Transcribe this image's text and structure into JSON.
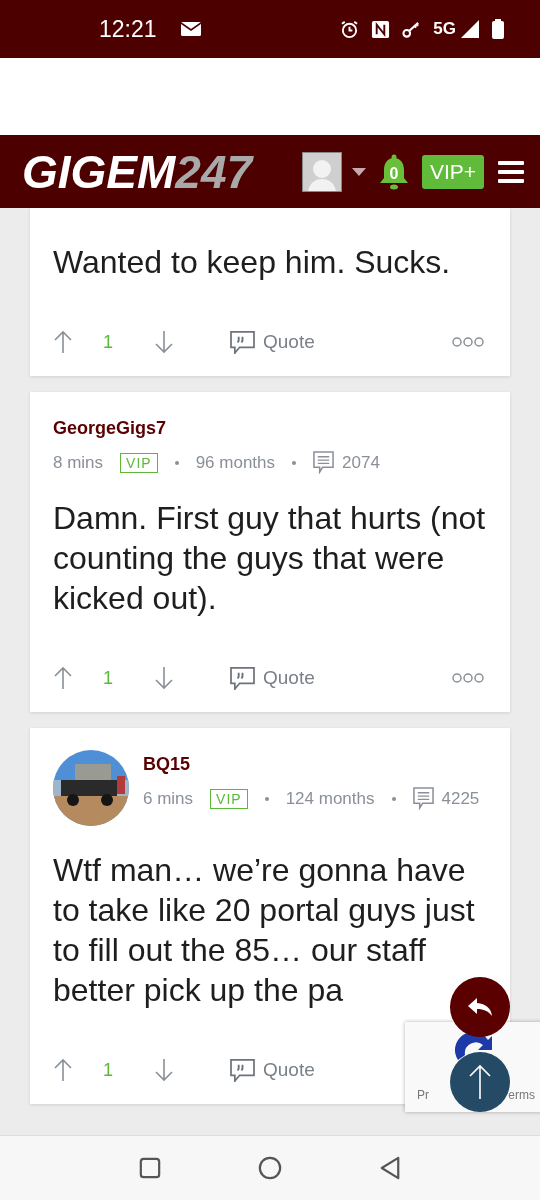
{
  "status_bar": {
    "time": "12:21",
    "network": "5G"
  },
  "header": {
    "logo_main": "GIGEM",
    "logo_accent": "247",
    "notifications": "0",
    "vip": "VIP+"
  },
  "posts": [
    {
      "body": "Wanted to keep him. Sucks.",
      "votes": "1",
      "quote": "Quote"
    },
    {
      "author": "GeorgeGigs7",
      "time": "8 mins",
      "badge": "VIP",
      "tenure": "96 months",
      "posts_count": "2074",
      "body": "Damn. First guy that hurts (not counting the guys that were kicked out).",
      "votes": "1",
      "quote": "Quote"
    },
    {
      "author": "BQ15",
      "time": "6 mins",
      "badge": "VIP",
      "tenure": "124 months",
      "posts_count": "4225",
      "body": "Wtf man… we’re gonna have to take like 20 portal guys just to fill out the 85… our staff better pick up the pa",
      "votes": "1",
      "quote": "Quote"
    }
  ],
  "recaptcha": {
    "left": "Pr",
    "right": "erms"
  }
}
